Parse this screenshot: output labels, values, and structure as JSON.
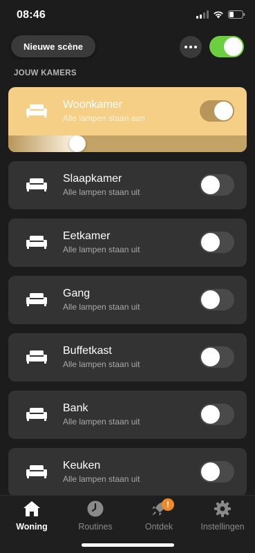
{
  "status_bar": {
    "time": "08:46"
  },
  "header": {
    "scene_button_label": "Nieuwe scène",
    "master_toggle_on": true
  },
  "section_title": "JOUW KAMERS",
  "rooms": [
    {
      "name": "Woonkamer",
      "status": "Alle lampen staan aan",
      "on": true,
      "brightness": 0.29
    },
    {
      "name": "Slaapkamer",
      "status": "Alle lampen staan uit",
      "on": false
    },
    {
      "name": "Eetkamer",
      "status": "Alle lampen staan uit",
      "on": false
    },
    {
      "name": "Gang",
      "status": "Alle lampen staan uit",
      "on": false
    },
    {
      "name": "Buffetkast",
      "status": "Alle lampen staan uit",
      "on": false
    },
    {
      "name": "Bank",
      "status": "Alle lampen staan uit",
      "on": false
    },
    {
      "name": "Keuken",
      "status": "Alle lampen staan uit",
      "on": false
    }
  ],
  "tabs": [
    {
      "label": "Woning",
      "icon": "home-icon",
      "active": true
    },
    {
      "label": "Routines",
      "icon": "clock-icon",
      "active": false
    },
    {
      "label": "Ontdek",
      "icon": "rocket-icon",
      "active": false,
      "badge": "!"
    },
    {
      "label": "Instellingen",
      "icon": "gear-icon",
      "active": false
    }
  ],
  "colors": {
    "accent_green": "#6bcf3f",
    "active_room": "#f6cf86",
    "badge_orange": "#ef8a2a"
  }
}
